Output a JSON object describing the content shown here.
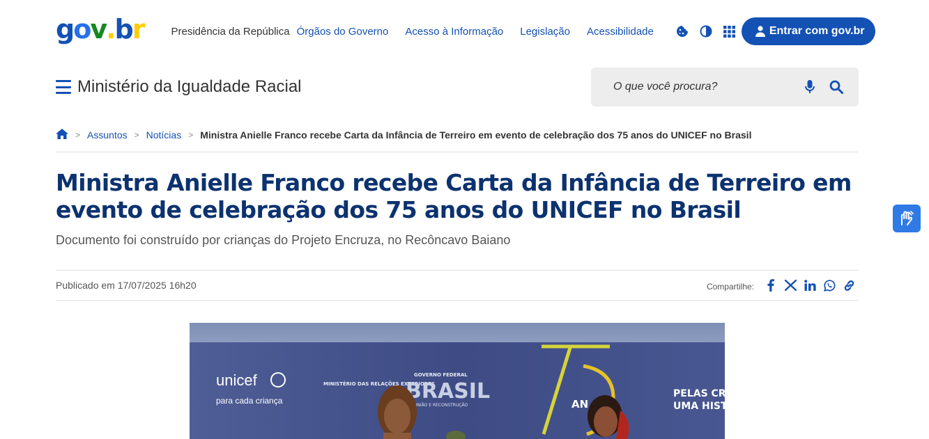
{
  "header": {
    "logo": {
      "g": "g",
      "o": "o",
      "v": "v",
      "dot": ".",
      "b": "b",
      "r": "r"
    },
    "presidencia": "Presidência da República",
    "links": [
      "Órgãos do Governo",
      "Acesso à Informação",
      "Legislação",
      "Acessibilidade"
    ],
    "icons": [
      "cookie-icon",
      "contrast-icon",
      "apps-grid-icon"
    ],
    "login_label": "Entrar com gov.br"
  },
  "site": {
    "title": "Ministério da Igualdade Racial",
    "search_placeholder": "O que você procura?"
  },
  "breadcrumb": {
    "items": [
      "Assuntos",
      "Notícias"
    ],
    "current": "Ministra Anielle Franco recebe Carta da Infância de Terreiro em evento de celebração dos 75 anos do UNICEF no Brasil",
    "separator": ">"
  },
  "article": {
    "title": "Ministra Anielle Franco recebe Carta da Infância de Terreiro em evento de celebração dos 75 anos do UNICEF no Brasil",
    "subtitle": "Documento foi construído por crianças do Projeto Encruza, no Recôncavo Baiano",
    "published": "Publicado em 17/07/2025 16h20",
    "share_label": "Compartilhe:",
    "share_icons": [
      "facebook-icon",
      "x-icon",
      "linkedin-icon",
      "whatsapp-icon",
      "link-icon"
    ]
  },
  "photo": {
    "backdrop_texts": {
      "unicef": "unicef",
      "unicef_tagline": "para cada criança",
      "ministry": "MINISTÉRIO DAS RELAÇÕES EXTERIORES",
      "gov_small": "GOVERNO FEDERAL",
      "brasil": "BRASIL",
      "gov_tagline": "UNIÃO E RECONSTRUÇÃO",
      "anos": "AN",
      "pelas_line1": "PELAS CR",
      "pelas_line2": "UMA HIST"
    }
  },
  "colors": {
    "primary": "#1351b4",
    "title": "#0c326f",
    "search_bg": "#ededed",
    "widget": "#2f7ae5"
  }
}
